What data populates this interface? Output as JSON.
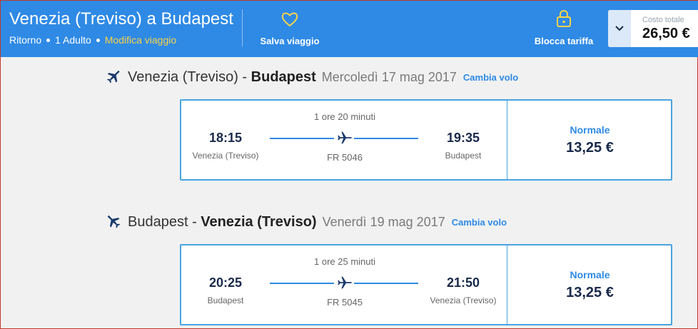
{
  "header": {
    "title": "Venezia (Treviso) a Budapest",
    "trip_type": "Ritorno",
    "passengers": "1 Adulto",
    "modify_label": "Modifica viaggio",
    "save_label": "Salva viaggio",
    "lock_label": "Blocca tariffa",
    "total_label": "Costo totale",
    "total_value": "26,50 €"
  },
  "legs": [
    {
      "from": "Venezia (Treviso)",
      "separator": " - ",
      "to": "Budapest",
      "bold_part": "to",
      "date": "Mercoledì 17 mag 2017",
      "change_label": "Cambia volo",
      "duration": "1 ore 20 minuti",
      "dep_time": "18:15",
      "dep_city": "Venezia (Treviso)",
      "arr_time": "19:35",
      "arr_city": "Budapest",
      "flight_no": "FR 5046",
      "fare_type": "Normale",
      "price": "13,25 €"
    },
    {
      "from": "Budapest",
      "separator": " - ",
      "to": "Venezia (Treviso)",
      "bold_part": "to",
      "date": "Venerdì 19 mag 2017",
      "change_label": "Cambia volo",
      "duration": "1 ore 25 minuti",
      "dep_time": "20:25",
      "dep_city": "Budapest",
      "arr_time": "21:50",
      "arr_city": "Venezia (Treviso)",
      "flight_no": "FR 5045",
      "fare_type": "Normale",
      "price": "13,25 €"
    }
  ],
  "colors": {
    "header_bg": "#2f8ae5",
    "accent_yellow": "#f8d24a",
    "card_border": "#4aa3df",
    "text_dark": "#1a2a4a"
  },
  "icons": {
    "heart": "heart-icon",
    "lock": "lock-icon",
    "chevron": "chevron-down-icon",
    "plane": "plane-icon"
  }
}
